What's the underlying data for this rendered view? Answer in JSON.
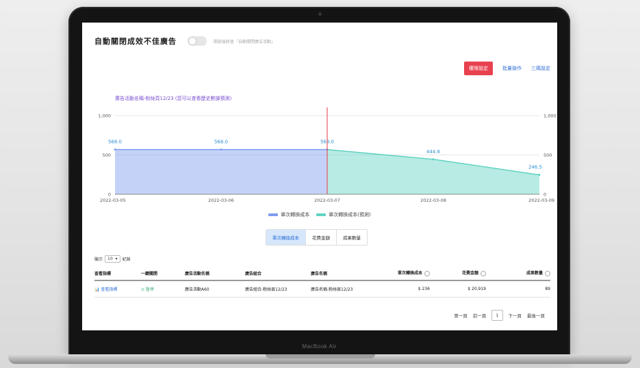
{
  "header": {
    "title": "自動關閉成效不佳廣告",
    "toggle_hint": "開啟後將會「自動關閉廣告活動」"
  },
  "actions": {
    "primary_label": "權限設定",
    "link1_label": "批量操作",
    "link2_label": "三碼設定"
  },
  "chart_data": {
    "type": "area",
    "title": "廣告活動名稱-粉絲頁12/23 (您可以查看歷史數據預測)",
    "x": [
      "2022-03-05",
      "2022-03-06",
      "2022-03-07",
      "2022-03-08",
      "2022-03-09"
    ],
    "y_ticks_left": [
      "0",
      "500",
      "1,000"
    ],
    "y_ticks_right": [
      "0",
      "500",
      "1,000"
    ],
    "ylim": [
      0,
      1000
    ],
    "series": [
      {
        "name": "單次轉換成本",
        "points": [
          [
            "2022-03-05",
            568.0
          ],
          [
            "2022-03-06",
            568.0
          ],
          [
            "2022-03-07",
            568.0
          ]
        ],
        "color": "#7f9cf0"
      },
      {
        "name": "單次轉換成本(預測)",
        "points": [
          [
            "2022-03-07",
            568.0
          ],
          [
            "2022-03-08",
            444.6
          ],
          [
            "2022-03-09",
            246.5
          ]
        ],
        "color": "#5fd3c2"
      }
    ],
    "point_labels": [
      "568.0",
      "568.0",
      "568.0",
      "444.6",
      "246.5"
    ],
    "marker_x": "2022-03-07",
    "legend_position": "bottom"
  },
  "legend": {
    "items": [
      "單次轉換成本",
      "單次轉換成本(預測)"
    ]
  },
  "tabs": [
    "單次轉換成本",
    "花費金額",
    "成果數量"
  ],
  "table": {
    "show_label": "顯示",
    "page_size": "10",
    "records_label": "紀錄",
    "headers": [
      "查看指標",
      "一鍵關閉",
      "廣告活動名稱",
      "廣告組合",
      "廣告名稱",
      "單次轉換成本",
      "花費金額",
      "成果數量"
    ],
    "row": [
      "查看指標",
      "暫停",
      "廣告活動A60",
      "廣告組合-粉絲頁12/23",
      "廣告名稱-粉絲頁12/23",
      "$ 236",
      "$ 20,919",
      "89"
    ]
  },
  "pager": {
    "first": "第一頁",
    "prev": "前一頁",
    "current": "1",
    "next": "下一頁",
    "last": "最後一頁"
  },
  "device": {
    "model": "MacBook Air"
  }
}
